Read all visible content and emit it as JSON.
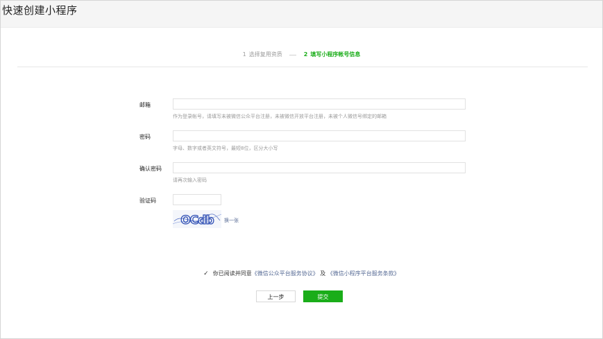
{
  "page": {
    "title": "快速创建小程序"
  },
  "steps": [
    {
      "num": "1",
      "label": "选择复用资质",
      "active": false
    },
    {
      "num": "2",
      "label": "填写小程序帐号信息",
      "active": true
    }
  ],
  "form": {
    "email": {
      "label": "邮箱",
      "value": "",
      "tip": "作为登录帐号，请填写未被微信公众平台注册，未被微信开放平台注册，未被个人微信号绑定的邮箱"
    },
    "password": {
      "label": "密码",
      "value": "",
      "tip": "字母、数字或者英文符号，最短8位，区分大小写"
    },
    "confirm_password": {
      "label": "确认密码",
      "value": "",
      "tip": "请再次输入密码"
    },
    "captcha": {
      "label": "验证码",
      "value": "",
      "image_text": "OCdb",
      "refresh_label": "换一张"
    }
  },
  "agreement": {
    "checked": true,
    "prefix": "你已阅读并同意",
    "link1": "《微信公众平台服务协议》",
    "and": "及",
    "link2": "《微信小程序平台服务条款》"
  },
  "buttons": {
    "prev_label": "上一步",
    "submit_label": "提交"
  },
  "colors": {
    "accent": "#1aad19",
    "link": "#576b95"
  }
}
